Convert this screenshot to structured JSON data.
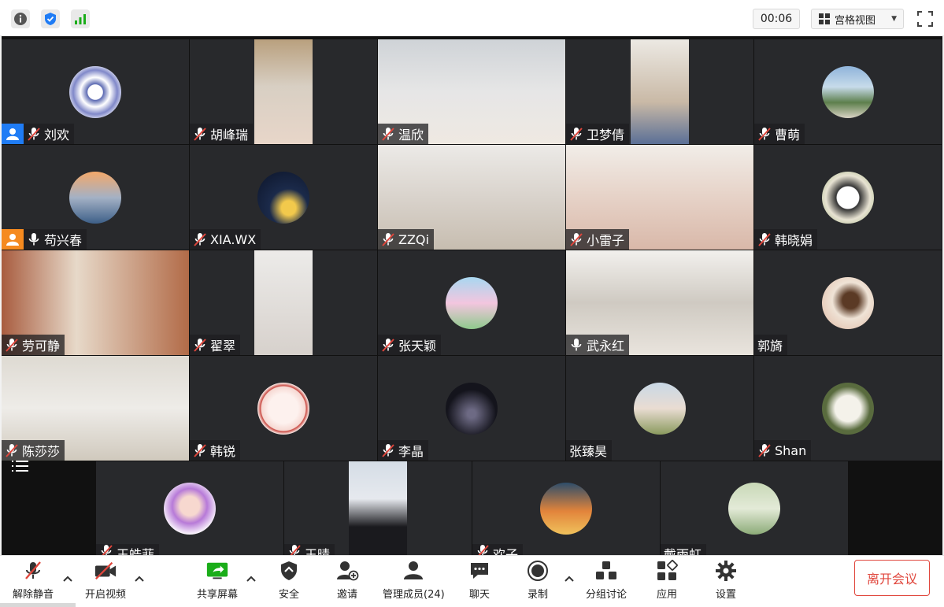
{
  "topbar": {
    "timer": "00:06",
    "view_label": "宫格视图",
    "info_icon": "info-icon",
    "shield_icon": "shield-icon",
    "signal_icon": "signal-icon",
    "fullscreen_icon": "fullscreen-icon"
  },
  "participants": [
    {
      "name": "刘欢",
      "mic": "muted",
      "host": true,
      "host_color": "#1f7cf5"
    },
    {
      "name": "胡峰瑞",
      "mic": "muted"
    },
    {
      "name": "温欣",
      "mic": "muted"
    },
    {
      "name": "卫梦倩",
      "mic": "muted"
    },
    {
      "name": "曹萌",
      "mic": "muted"
    },
    {
      "name": "苟兴春",
      "mic": "on",
      "host": true,
      "host_color": "#f58a1f"
    },
    {
      "name": "XIA.WX",
      "mic": "muted"
    },
    {
      "name": "ZZQi",
      "mic": "muted"
    },
    {
      "name": "小雷子",
      "mic": "muted"
    },
    {
      "name": "韩晓娟",
      "mic": "muted"
    },
    {
      "name": "劳可静",
      "mic": "muted"
    },
    {
      "name": "翟翠",
      "mic": "muted"
    },
    {
      "name": "张天颖",
      "mic": "muted"
    },
    {
      "name": "武永红",
      "mic": "on"
    },
    {
      "name": "郭旖",
      "mic": "none"
    },
    {
      "name": "陈莎莎",
      "mic": "muted"
    },
    {
      "name": "韩锐",
      "mic": "muted"
    },
    {
      "name": "李晶",
      "mic": "muted"
    },
    {
      "name": "张臻昊",
      "mic": "none"
    },
    {
      "name": "Shan",
      "mic": "muted"
    },
    {
      "name": "王皓菲",
      "mic": "muted"
    },
    {
      "name": "王晴",
      "mic": "muted"
    },
    {
      "name": "欢子",
      "mic": "muted"
    },
    {
      "name": "戴雨虹",
      "mic": "none"
    }
  ],
  "toolbar": {
    "unmute": "解除静音",
    "start_video": "开启视频",
    "share_screen": "共享屏幕",
    "security": "安全",
    "invite": "邀请",
    "manage_members": "管理成员(24)",
    "chat": "聊天",
    "record": "录制",
    "breakout": "分组讨论",
    "apps": "应用",
    "settings": "设置",
    "leave": "离开会议"
  },
  "colors": {
    "tile_bg": "#28292c",
    "leave_red": "#e0463c",
    "share_green": "#1aad19"
  }
}
